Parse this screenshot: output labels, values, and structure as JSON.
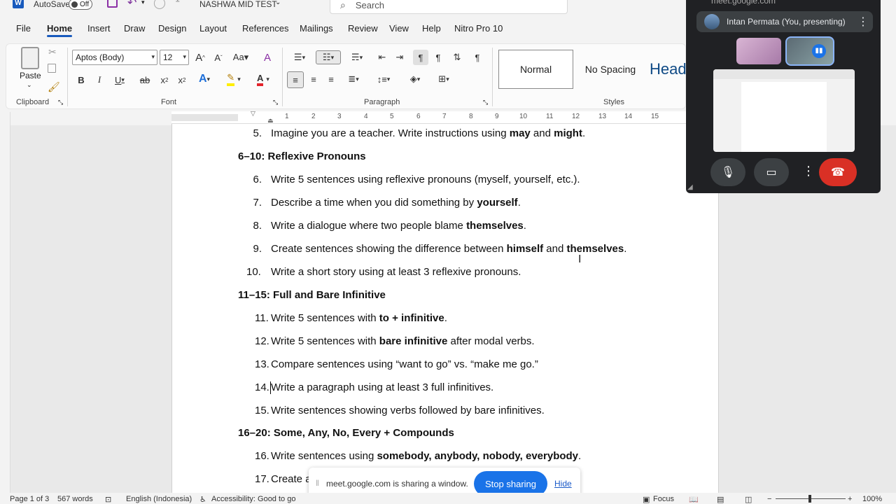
{
  "titlebar": {
    "autosave_label": "AutoSave",
    "autosave_state": "Off",
    "doc_title": "NASHWA MID TEST",
    "search_placeholder": "Search"
  },
  "tabs": [
    "File",
    "Home",
    "Insert",
    "Draw",
    "Design",
    "Layout",
    "References",
    "Mailings",
    "Review",
    "View",
    "Help",
    "Nitro Pro 10"
  ],
  "ribbon": {
    "paste_label": "Paste",
    "font_name": "Aptos (Body)",
    "font_size": "12",
    "groups": {
      "clipboard": "Clipboard",
      "font": "Font",
      "paragraph": "Paragraph",
      "styles": "Styles"
    },
    "styles": [
      "Normal",
      "No Spacing",
      "Head"
    ]
  },
  "ruler_numbers": [
    "1",
    "2",
    "3",
    "4",
    "5",
    "6",
    "7",
    "8",
    "9",
    "10",
    "11",
    "12",
    "13",
    "14",
    "15"
  ],
  "document": {
    "item5": {
      "num": "5.",
      "pre": "Imagine you are a teacher. Write instructions using ",
      "b1": "may",
      "mid": " and ",
      "b2": "might",
      "post": "."
    },
    "heading1": "6–10: Reflexive Pronouns",
    "item6": {
      "num": "6.",
      "text": "Write 5 sentences using reflexive pronouns (myself, yourself, etc.)."
    },
    "item7": {
      "num": "7.",
      "pre": "Describe a time when you did something by ",
      "b1": "yourself",
      "post": "."
    },
    "item8": {
      "num": "8.",
      "pre": "Write a dialogue where two people blame ",
      "b1": "themselves",
      "post": "."
    },
    "item9": {
      "num": "9.",
      "pre": "Create sentences showing the difference between ",
      "b1": "himself",
      "mid": " and ",
      "b2": "themselves",
      "post": "."
    },
    "item10": {
      "num": "10.",
      "text": "Write a short story using at least 3 reflexive pronouns."
    },
    "heading2": "11–15: Full and Bare Infinitive",
    "item11": {
      "num": "11.",
      "pre": "Write 5 sentences with ",
      "b1": "to + infinitive",
      "post": "."
    },
    "item12": {
      "num": "12.",
      "pre": "Write 5 sentences with ",
      "b1": "bare infinitive",
      "post": " after modal verbs."
    },
    "item13": {
      "num": "13.",
      "text": "Compare sentences using “want to go” vs. “make me go.”"
    },
    "item14": {
      "num": "14.",
      "text": "Write a paragraph using at least 3 full infinitives."
    },
    "item15": {
      "num": "15.",
      "text": "Write sentences showing verbs followed by bare infinitives."
    },
    "heading3": "16–20: Some, Any, No, Every + Compounds",
    "item16": {
      "num": "16.",
      "pre": "Write sentences using ",
      "b1": "somebody, anybody, nobody, everybody",
      "post": "."
    },
    "item17": {
      "num": "17.",
      "text": "Create a"
    }
  },
  "meet": {
    "url": "meet.google.com",
    "presenter": "Intan Permata (You, presenting)",
    "end_call_color": "#d93025"
  },
  "sharebar": {
    "message": "meet.google.com is sharing a window.",
    "stop_label": "Stop sharing",
    "hide_label": "Hide",
    "accent": "#1a73e8"
  },
  "status": {
    "page": "Page 1 of 3",
    "words": "567 words",
    "language": "English (Indonesia)",
    "accessibility": "Accessibility: Good to go",
    "focus": "Focus",
    "zoom": "100%"
  }
}
